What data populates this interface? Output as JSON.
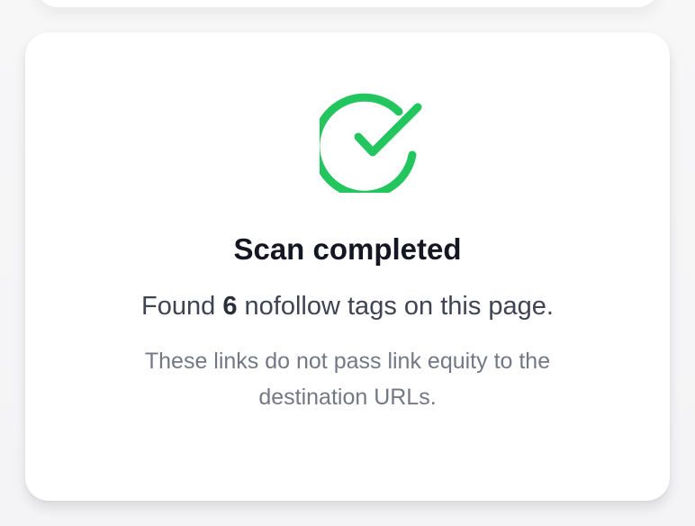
{
  "status": {
    "icon": "check-circle-icon",
    "accent_color": "#22c55e",
    "title": "Scan completed"
  },
  "result": {
    "prefix": "Found",
    "count": "6",
    "suffix": "nofollow tags on this page."
  },
  "note": "These links do not pass link equity to the destination URLs."
}
